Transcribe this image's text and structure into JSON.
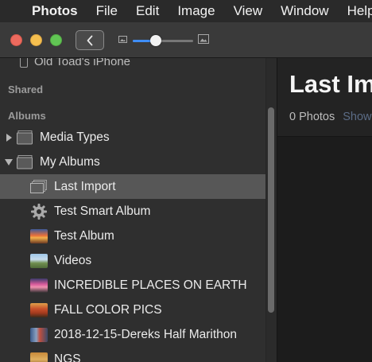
{
  "menubar": {
    "items": [
      "Photos",
      "File",
      "Edit",
      "Image",
      "View",
      "Window",
      "Help"
    ]
  },
  "toolbar": {
    "zoom_level": 0.38
  },
  "sidebar": {
    "device_label": "Old Toad's iPhone",
    "shared_header": "Shared",
    "albums_header": "Albums",
    "rows": [
      {
        "label": "Media Types",
        "icon": "folder-icon",
        "expanded": false
      },
      {
        "label": "My Albums",
        "icon": "folder-icon",
        "expanded": true
      },
      {
        "label": "Last Import",
        "icon": "album-stack-icon",
        "selected": true
      },
      {
        "label": "Test Smart Album",
        "icon": "gear-icon"
      },
      {
        "label": "Test Album",
        "icon": "photo-thumbnail-sunset"
      },
      {
        "label": "Videos",
        "icon": "photo-thumbnail-landscape"
      },
      {
        "label": "INCREDIBLE PLACES ON EARTH",
        "icon": "photo-thumbnail-pink"
      },
      {
        "label": "FALL COLOR PICS",
        "icon": "photo-thumbnail-fall"
      },
      {
        "label": "2018-12-15-Dereks Half Marithon",
        "icon": "photo-thumbnail-people"
      },
      {
        "label": "NGS",
        "icon": "photo-thumbnail-ngs"
      }
    ]
  },
  "main": {
    "title": "Last Import",
    "count": "0 Photos",
    "link": "Show"
  },
  "colors": {
    "accent": "#3f8ef7",
    "selected_row": "#575757",
    "sidebar_bg": "#2f2f2f"
  }
}
